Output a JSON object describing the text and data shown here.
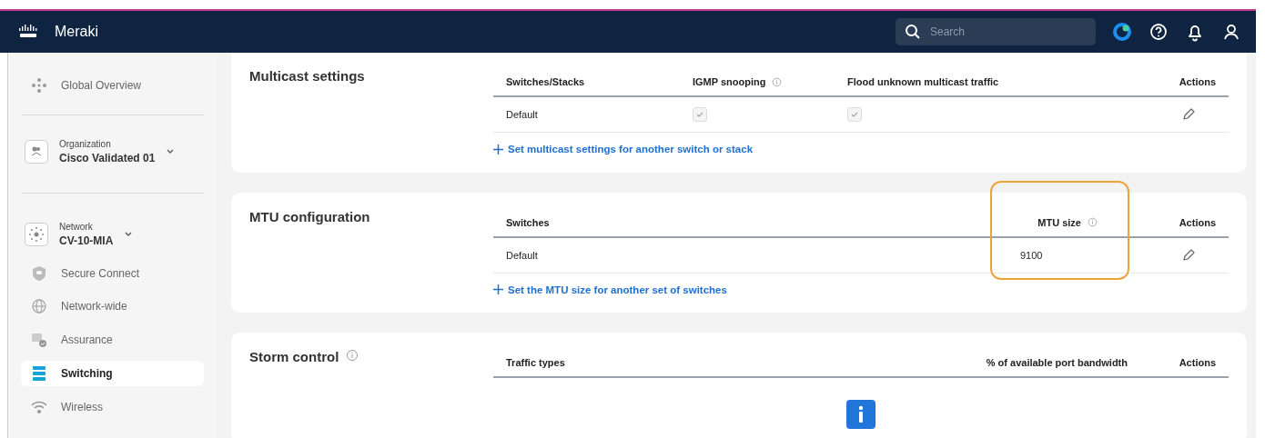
{
  "header": {
    "brand": "Meraki",
    "search": {
      "placeholder": "Search"
    }
  },
  "sidebar": {
    "items": [
      {
        "kind": "link",
        "label": "Global Overview",
        "selected": false
      },
      {
        "kind": "selector",
        "caption": "Organization",
        "label": "Cisco Validated 01"
      },
      {
        "kind": "selector",
        "caption": "Network",
        "label": "CV-10-MIA"
      },
      {
        "kind": "link",
        "label": "Secure Connect",
        "selected": false
      },
      {
        "kind": "link",
        "label": "Network-wide",
        "selected": false
      },
      {
        "kind": "link",
        "label": "Assurance",
        "selected": false
      },
      {
        "kind": "link",
        "label": "Switching",
        "selected": true
      },
      {
        "kind": "link",
        "label": "Wireless",
        "selected": false
      }
    ]
  },
  "sections": [
    {
      "title": "Multicast settings",
      "info": false,
      "columns": [
        {
          "label": "Switches/Stacks",
          "info": false,
          "highlighted": false
        },
        {
          "label": "IGMP snooping",
          "info": true,
          "highlighted": false
        },
        {
          "label": "Flood unknown multicast traffic",
          "info": false,
          "highlighted": false
        },
        {
          "label": "Actions",
          "info": false,
          "highlighted": false
        }
      ],
      "rows": [
        {
          "cells": [
            {
              "kind": "text",
              "text": "Default"
            },
            {
              "kind": "checkbox",
              "checked": true,
              "disabled": true
            },
            {
              "kind": "checkbox",
              "checked": true,
              "disabled": true
            },
            {
              "kind": "edit"
            }
          ]
        }
      ],
      "add_link": "Set multicast settings for another switch or stack"
    },
    {
      "title": "MTU configuration",
      "info": false,
      "columns": [
        {
          "label": "Switches",
          "info": false,
          "highlighted": false
        },
        {
          "label": "MTU size",
          "info": true,
          "highlighted": true
        },
        {
          "label": "Actions",
          "info": false,
          "highlighted": false
        }
      ],
      "rows": [
        {
          "cells": [
            {
              "kind": "text",
              "text": "Default"
            },
            {
              "kind": "text",
              "text": "9100"
            },
            {
              "kind": "edit"
            }
          ]
        }
      ],
      "add_link": "Set the MTU size for another set of switches"
    },
    {
      "title": "Storm control",
      "info": true,
      "columns": [
        {
          "label": "Traffic types",
          "info": false,
          "highlighted": false
        },
        {
          "label": "% of available port bandwidth",
          "info": false,
          "highlighted": false
        },
        {
          "label": "Actions",
          "info": false,
          "highlighted": false
        }
      ],
      "empty_state": true
    }
  ]
}
